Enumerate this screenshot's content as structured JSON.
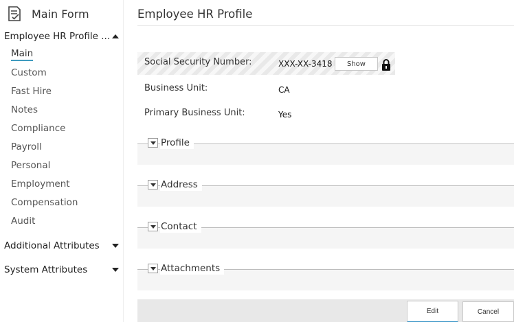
{
  "sidebar": {
    "header_title": "Main Form",
    "section_main": "Employee HR Profile ...",
    "items": [
      "Main",
      "Custom",
      "Fast Hire",
      "Notes",
      "Compliance",
      "Payroll",
      "Personal",
      "Employment",
      "Compensation",
      "Audit"
    ],
    "active_item": "Main",
    "section_additional": "Additional Attributes",
    "section_system": "System Attributes"
  },
  "main": {
    "page_title": "Employee HR Profile",
    "fields": {
      "ssn_label": "Social Security Number:",
      "ssn_value": "XXX-XX-3418",
      "ssn_show_label": "Show",
      "business_unit_label": "Business Unit:",
      "business_unit_value": "CA",
      "primary_bu_label": "Primary Business Unit:",
      "primary_bu_value": "Yes"
    },
    "groups": [
      "Profile",
      "Address",
      "Contact",
      "Attachments"
    ]
  },
  "footer": {
    "edit_label": "Edit",
    "cancel_label": "Cancel"
  },
  "colors": {
    "accent": "#3f9bbf",
    "edit_underline": "#2f8fc4",
    "masked_band": "#e9e9e9"
  },
  "icons": {
    "header": "form-checklist-icon",
    "lock": "lock-icon",
    "collapse": "caret-up-icon",
    "expand": "caret-down-icon",
    "group_toggle": "dropdown-toggle-icon"
  }
}
